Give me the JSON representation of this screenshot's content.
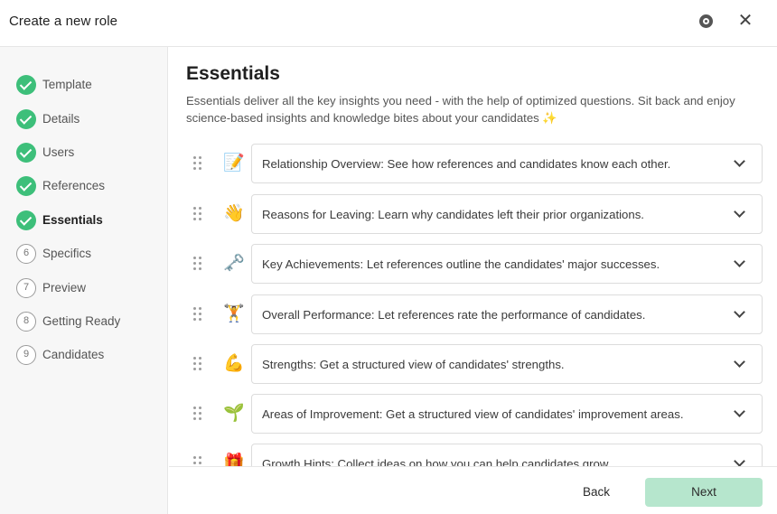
{
  "header": {
    "title": "Create a new role"
  },
  "sidebar": {
    "steps": [
      {
        "label": "Template",
        "status": "done"
      },
      {
        "label": "Details",
        "status": "done"
      },
      {
        "label": "Users",
        "status": "done"
      },
      {
        "label": "References",
        "status": "done"
      },
      {
        "label": "Essentials",
        "status": "done",
        "active": true
      },
      {
        "number": "6",
        "label": "Specifics",
        "status": "todo"
      },
      {
        "number": "7",
        "label": "Preview",
        "status": "todo"
      },
      {
        "number": "8",
        "label": "Getting Ready",
        "status": "todo"
      },
      {
        "number": "9",
        "label": "Candidates",
        "status": "todo"
      }
    ]
  },
  "main": {
    "title": "Essentials",
    "description": "Essentials deliver all the key insights you need - with the help of optimized questions. Sit back and enjoy science-based insights and knowledge bites about your candidates ✨",
    "items": [
      {
        "emoji": "📝",
        "text": "Relationship Overview: See how references and candidates know each other."
      },
      {
        "emoji": "👋",
        "text": "Reasons for Leaving: Learn why candidates left their prior organizations."
      },
      {
        "emoji": "🗝️",
        "text": "Key Achievements: Let references outline the candidates' major successes."
      },
      {
        "emoji": "🏋️",
        "text": "Overall Performance: Let references rate the performance of candidates."
      },
      {
        "emoji": "💪",
        "text": "Strengths: Get a structured view of candidates' strengths."
      },
      {
        "emoji": "🌱",
        "text": "Areas of Improvement: Get a structured view of candidates' improvement areas."
      },
      {
        "emoji": "🎁",
        "text": "Growth Hints: Collect ideas on how you can help candidates grow."
      }
    ]
  },
  "footer": {
    "back_label": "Back",
    "next_label": "Next"
  },
  "colors": {
    "accent_done": "#3dbf7a",
    "next_button": "#b6e6cd"
  }
}
